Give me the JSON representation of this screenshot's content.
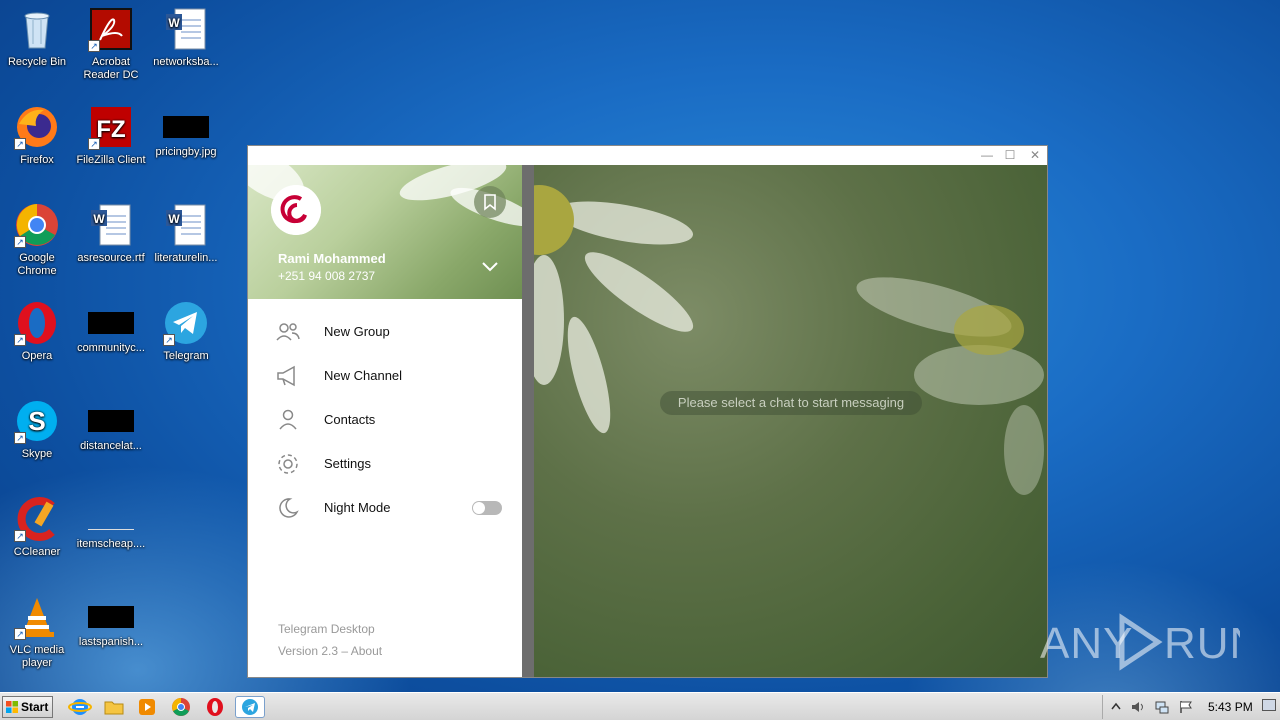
{
  "desktop": {
    "icons": [
      {
        "label": "Recycle Bin"
      },
      {
        "label": "Acrobat Reader DC"
      },
      {
        "label": "networksba..."
      },
      {
        "label": "Firefox"
      },
      {
        "label": "FileZilla Client"
      },
      {
        "label": "pricingby.jpg"
      },
      {
        "label": "Google Chrome"
      },
      {
        "label": "asresource.rtf"
      },
      {
        "label": "literaturelin..."
      },
      {
        "label": "Opera"
      },
      {
        "label": "communityc..."
      },
      {
        "label": "Telegram"
      },
      {
        "label": "Skype"
      },
      {
        "label": "distancelat..."
      },
      {
        "label": "CCleaner"
      },
      {
        "label": "itemscheap...."
      },
      {
        "label": "VLC media player"
      },
      {
        "label": "lastspanish..."
      }
    ]
  },
  "telegram": {
    "window_buttons": {
      "minimize": "—",
      "maximize": "☐",
      "close": "✕"
    },
    "user": {
      "name": "Rami Mohammed",
      "phone": "+251 94 008 2737"
    },
    "menu": [
      {
        "label": "New Group",
        "icon": "group-icon"
      },
      {
        "label": "New Channel",
        "icon": "megaphone-icon"
      },
      {
        "label": "Contacts",
        "icon": "person-icon"
      },
      {
        "label": "Settings",
        "icon": "gear-icon"
      },
      {
        "label": "Night Mode",
        "icon": "moon-icon",
        "toggle": false
      }
    ],
    "footer": {
      "app": "Telegram Desktop",
      "version": "Version 2.3 – About"
    },
    "chat_placeholder": "Please select a chat to start messaging"
  },
  "watermark": "ANY RUN",
  "taskbar": {
    "start_label": "Start",
    "clock": "5:43 PM"
  }
}
